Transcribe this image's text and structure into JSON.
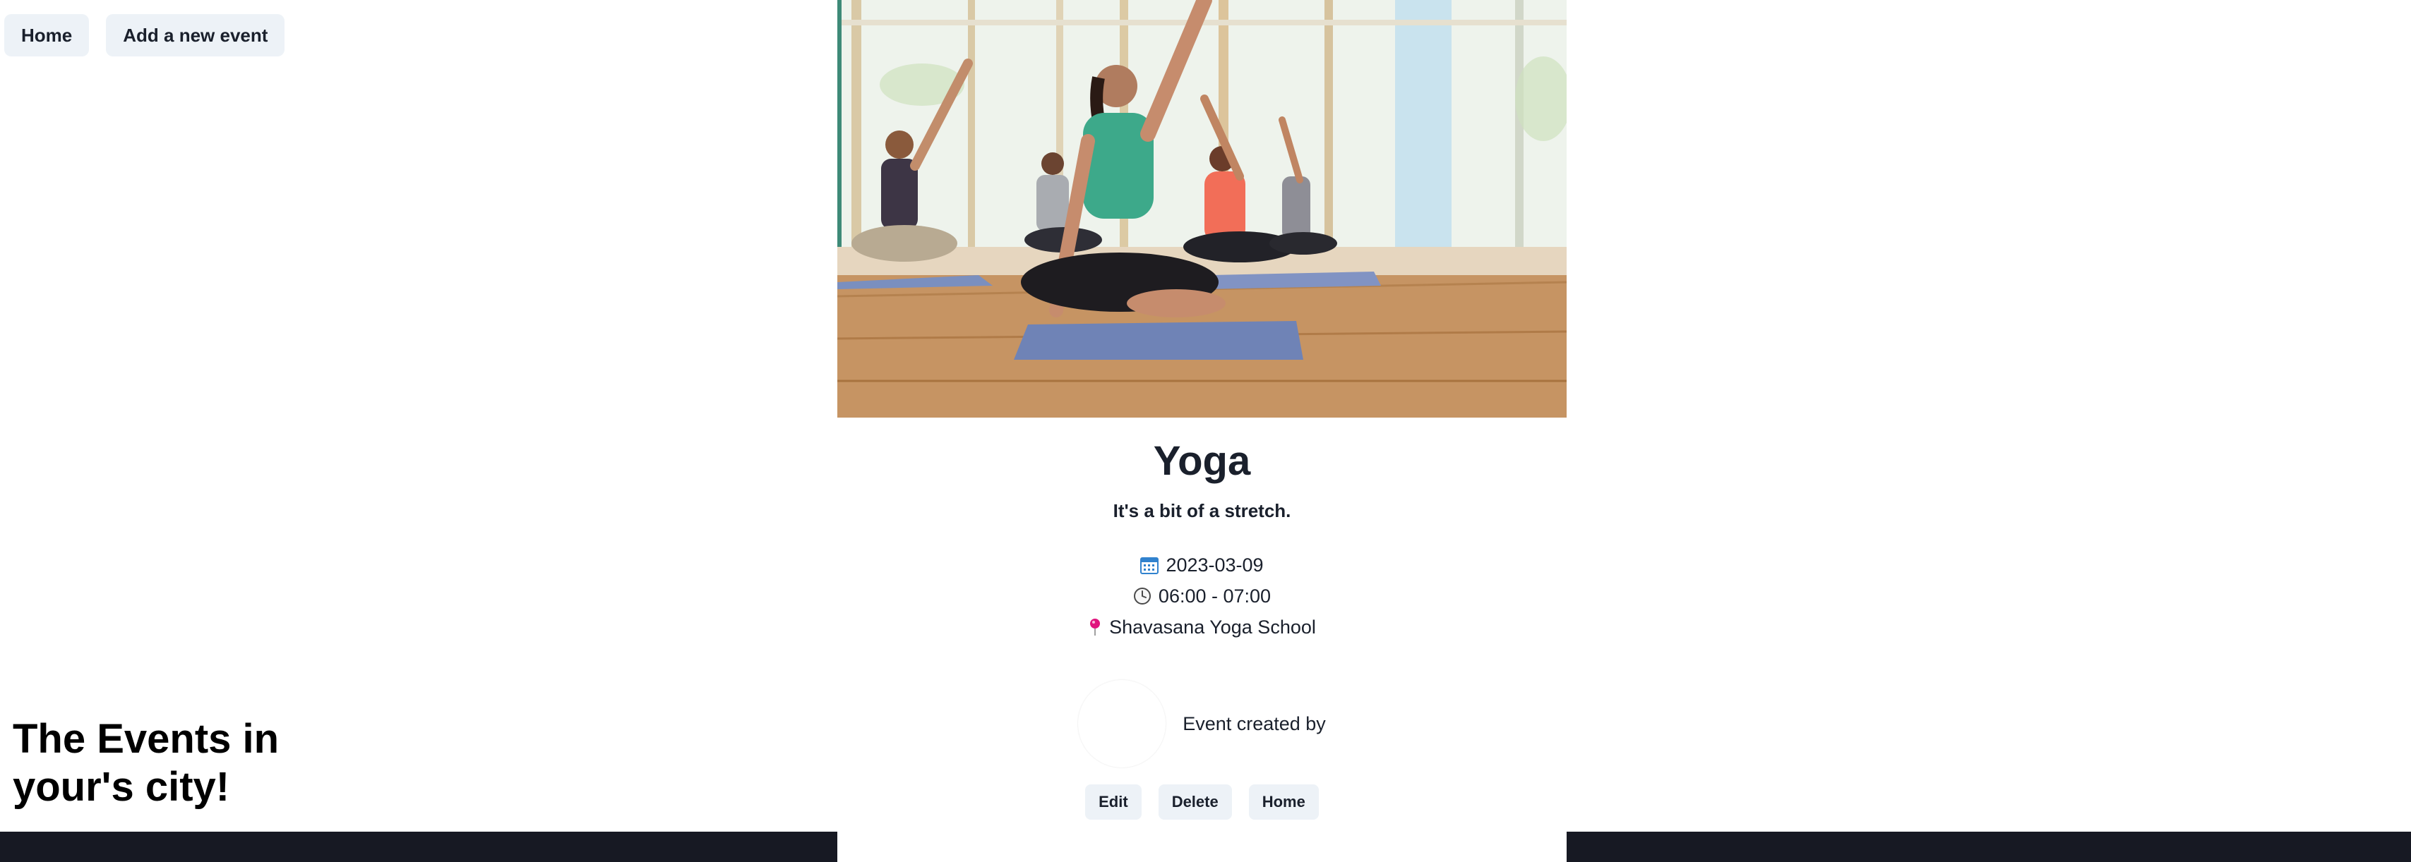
{
  "nav": {
    "home_label": "Home",
    "add_event_label": "Add a new event"
  },
  "tagline": "The Events in your's city!",
  "event": {
    "image_alt": "Yoga class",
    "title": "Yoga",
    "subtitle": "It's a bit of a stretch.",
    "date": "2023-03-09",
    "time": "06:00 - 07:00",
    "location": "Shavasana Yoga School",
    "created_by_label": "Event created by"
  },
  "actions": {
    "edit_label": "Edit",
    "delete_label": "Delete",
    "home_label": "Home"
  },
  "icons": {
    "date": "calendar-icon",
    "time": "clock-icon",
    "location": "map-pin-icon"
  },
  "colors": {
    "button_bg": "#edf2f7",
    "footer_bg": "#171923",
    "text": "#1a202c",
    "pin": "#e0157e",
    "calendar": "#3182ce"
  }
}
